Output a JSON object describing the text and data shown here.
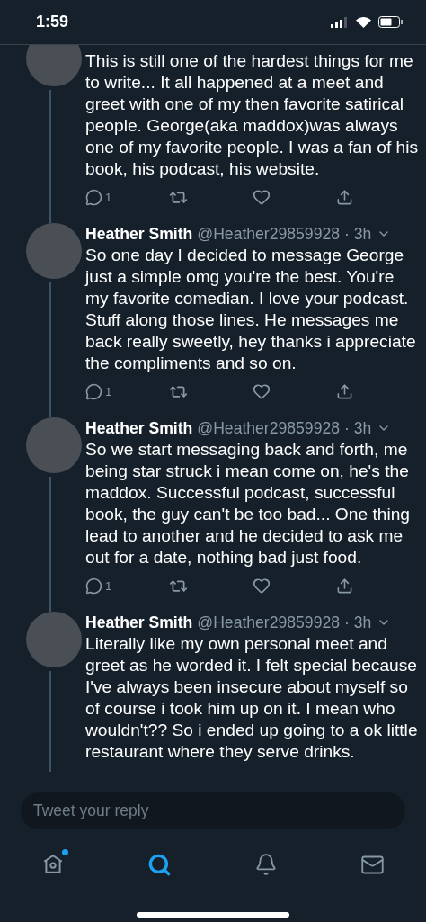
{
  "status_bar": {
    "time": "1:59"
  },
  "tweets": [
    {
      "cut_top": true,
      "text": "This is still one of the hardest things for me to write... It all happened at a meet and greet with one of my then favorite satirical people. George(aka maddox)was always one of my favorite people. I was a fan of his book, his podcast, his website.",
      "actions": {
        "replies": "1"
      }
    },
    {
      "name": "Heather Smith",
      "handle": "@Heather29859928",
      "time": "· 3h",
      "cut_top": false,
      "text": "So one day I decided to message George just a simple omg you're the best. You're my favorite comedian. I love your podcast. Stuff along those lines. He messages me back really sweetly, hey thanks i appreciate the compliments and so on.",
      "actions": {
        "replies": "1"
      }
    },
    {
      "name": "Heather Smith",
      "handle": "@Heather29859928",
      "time": "· 3h",
      "cut_top": false,
      "text": "So we start messaging back and forth, me being star struck i mean come on, he's the maddox. Successful podcast, successful book, the guy can't be too bad... One thing lead to another and he decided to ask me out for a date, nothing bad just food.",
      "actions": {
        "replies": "1"
      }
    },
    {
      "name": "Heather Smith",
      "handle": "@Heather29859928",
      "time": "· 3h",
      "cut_top": false,
      "text": "Literally like my own personal meet and greet as he worded it. I felt special because I've always been insecure about myself so of course i took him up on it. I mean who wouldn't?? So i ended up going to a ok little restaurant where they serve drinks."
    }
  ],
  "reply_box": {
    "placeholder": "Tweet your reply"
  },
  "nav": [
    {
      "kind": "home",
      "selected": false,
      "notification": true
    },
    {
      "kind": "search",
      "selected": true
    },
    {
      "kind": "bell",
      "selected": false
    },
    {
      "kind": "mail",
      "selected": false
    }
  ]
}
